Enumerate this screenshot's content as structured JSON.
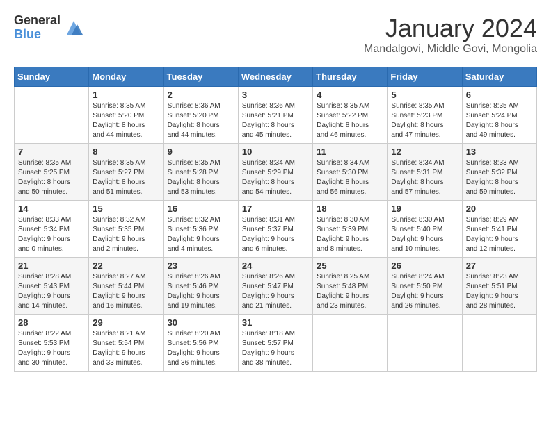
{
  "header": {
    "logo_general": "General",
    "logo_blue": "Blue",
    "month_title": "January 2024",
    "subtitle": "Mandalgovi, Middle Govi, Mongolia"
  },
  "calendar": {
    "days_of_week": [
      "Sunday",
      "Monday",
      "Tuesday",
      "Wednesday",
      "Thursday",
      "Friday",
      "Saturday"
    ],
    "weeks": [
      [
        {
          "day": "",
          "info": ""
        },
        {
          "day": "1",
          "info": "Sunrise: 8:35 AM\nSunset: 5:20 PM\nDaylight: 8 hours\nand 44 minutes."
        },
        {
          "day": "2",
          "info": "Sunrise: 8:36 AM\nSunset: 5:20 PM\nDaylight: 8 hours\nand 44 minutes."
        },
        {
          "day": "3",
          "info": "Sunrise: 8:36 AM\nSunset: 5:21 PM\nDaylight: 8 hours\nand 45 minutes."
        },
        {
          "day": "4",
          "info": "Sunrise: 8:35 AM\nSunset: 5:22 PM\nDaylight: 8 hours\nand 46 minutes."
        },
        {
          "day": "5",
          "info": "Sunrise: 8:35 AM\nSunset: 5:23 PM\nDaylight: 8 hours\nand 47 minutes."
        },
        {
          "day": "6",
          "info": "Sunrise: 8:35 AM\nSunset: 5:24 PM\nDaylight: 8 hours\nand 49 minutes."
        }
      ],
      [
        {
          "day": "7",
          "info": "Sunrise: 8:35 AM\nSunset: 5:25 PM\nDaylight: 8 hours\nand 50 minutes."
        },
        {
          "day": "8",
          "info": "Sunrise: 8:35 AM\nSunset: 5:27 PM\nDaylight: 8 hours\nand 51 minutes."
        },
        {
          "day": "9",
          "info": "Sunrise: 8:35 AM\nSunset: 5:28 PM\nDaylight: 8 hours\nand 53 minutes."
        },
        {
          "day": "10",
          "info": "Sunrise: 8:34 AM\nSunset: 5:29 PM\nDaylight: 8 hours\nand 54 minutes."
        },
        {
          "day": "11",
          "info": "Sunrise: 8:34 AM\nSunset: 5:30 PM\nDaylight: 8 hours\nand 56 minutes."
        },
        {
          "day": "12",
          "info": "Sunrise: 8:34 AM\nSunset: 5:31 PM\nDaylight: 8 hours\nand 57 minutes."
        },
        {
          "day": "13",
          "info": "Sunrise: 8:33 AM\nSunset: 5:32 PM\nDaylight: 8 hours\nand 59 minutes."
        }
      ],
      [
        {
          "day": "14",
          "info": "Sunrise: 8:33 AM\nSunset: 5:34 PM\nDaylight: 9 hours\nand 0 minutes."
        },
        {
          "day": "15",
          "info": "Sunrise: 8:32 AM\nSunset: 5:35 PM\nDaylight: 9 hours\nand 2 minutes."
        },
        {
          "day": "16",
          "info": "Sunrise: 8:32 AM\nSunset: 5:36 PM\nDaylight: 9 hours\nand 4 minutes."
        },
        {
          "day": "17",
          "info": "Sunrise: 8:31 AM\nSunset: 5:37 PM\nDaylight: 9 hours\nand 6 minutes."
        },
        {
          "day": "18",
          "info": "Sunrise: 8:30 AM\nSunset: 5:39 PM\nDaylight: 9 hours\nand 8 minutes."
        },
        {
          "day": "19",
          "info": "Sunrise: 8:30 AM\nSunset: 5:40 PM\nDaylight: 9 hours\nand 10 minutes."
        },
        {
          "day": "20",
          "info": "Sunrise: 8:29 AM\nSunset: 5:41 PM\nDaylight: 9 hours\nand 12 minutes."
        }
      ],
      [
        {
          "day": "21",
          "info": "Sunrise: 8:28 AM\nSunset: 5:43 PM\nDaylight: 9 hours\nand 14 minutes."
        },
        {
          "day": "22",
          "info": "Sunrise: 8:27 AM\nSunset: 5:44 PM\nDaylight: 9 hours\nand 16 minutes."
        },
        {
          "day": "23",
          "info": "Sunrise: 8:26 AM\nSunset: 5:46 PM\nDaylight: 9 hours\nand 19 minutes."
        },
        {
          "day": "24",
          "info": "Sunrise: 8:26 AM\nSunset: 5:47 PM\nDaylight: 9 hours\nand 21 minutes."
        },
        {
          "day": "25",
          "info": "Sunrise: 8:25 AM\nSunset: 5:48 PM\nDaylight: 9 hours\nand 23 minutes."
        },
        {
          "day": "26",
          "info": "Sunrise: 8:24 AM\nSunset: 5:50 PM\nDaylight: 9 hours\nand 26 minutes."
        },
        {
          "day": "27",
          "info": "Sunrise: 8:23 AM\nSunset: 5:51 PM\nDaylight: 9 hours\nand 28 minutes."
        }
      ],
      [
        {
          "day": "28",
          "info": "Sunrise: 8:22 AM\nSunset: 5:53 PM\nDaylight: 9 hours\nand 30 minutes."
        },
        {
          "day": "29",
          "info": "Sunrise: 8:21 AM\nSunset: 5:54 PM\nDaylight: 9 hours\nand 33 minutes."
        },
        {
          "day": "30",
          "info": "Sunrise: 8:20 AM\nSunset: 5:56 PM\nDaylight: 9 hours\nand 36 minutes."
        },
        {
          "day": "31",
          "info": "Sunrise: 8:18 AM\nSunset: 5:57 PM\nDaylight: 9 hours\nand 38 minutes."
        },
        {
          "day": "",
          "info": ""
        },
        {
          "day": "",
          "info": ""
        },
        {
          "day": "",
          "info": ""
        }
      ]
    ]
  }
}
